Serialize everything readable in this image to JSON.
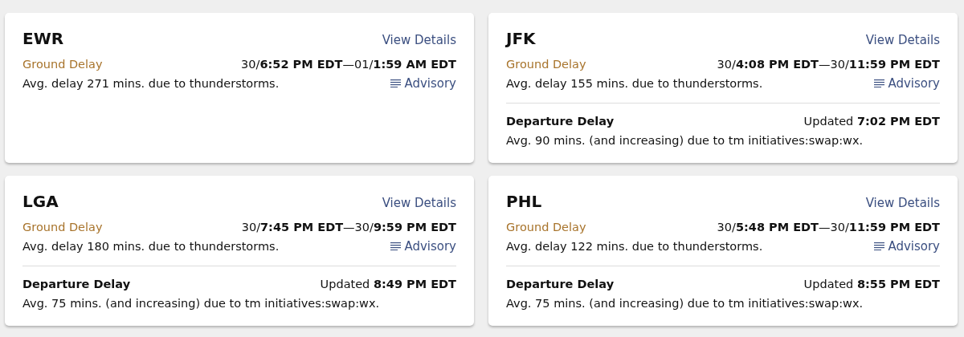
{
  "airports": [
    {
      "code": "EWR",
      "link": "View Details",
      "delays": [
        {
          "kind": "ground",
          "title": "Ground Delay",
          "time": "30/**6:52 PM EDT**—01/**1:59 AM EDT**",
          "text": "Avg. delay 271 mins. due to thunderstorms.",
          "advisory": "Advisory"
        }
      ]
    },
    {
      "code": "JFK",
      "link": "View Details",
      "delays": [
        {
          "kind": "ground",
          "title": "Ground Delay",
          "time": "30/**4:08 PM EDT**—30/**11:59 PM EDT**",
          "text": "Avg. delay 155 mins. due to thunderstorms.",
          "advisory": "Advisory"
        },
        {
          "kind": "departure",
          "title": "Departure Delay",
          "time": "Updated **7:02 PM EDT**",
          "text": "Avg. 90 mins. (and increasing) due to tm initiatives:swap:wx."
        }
      ]
    },
    {
      "code": "LGA",
      "link": "View Details",
      "delays": [
        {
          "kind": "ground",
          "title": "Ground Delay",
          "time": "30/**7:45 PM EDT**—30/**9:59 PM EDT**",
          "text": "Avg. delay 180 mins. due to thunderstorms.",
          "advisory": "Advisory"
        },
        {
          "kind": "departure",
          "title": "Departure Delay",
          "time": "Updated **8:49 PM EDT**",
          "text": "Avg. 75 mins. (and increasing) due to tm initiatives:swap:wx."
        }
      ]
    },
    {
      "code": "PHL",
      "link": "View Details",
      "delays": [
        {
          "kind": "ground",
          "title": "Ground Delay",
          "time": "30/**5:48 PM EDT**—30/**11:59 PM EDT**",
          "text": "Avg. delay 122 mins. due to thunderstorms.",
          "advisory": "Advisory"
        },
        {
          "kind": "departure",
          "title": "Departure Delay",
          "time": "Updated **8:55 PM EDT**",
          "text": "Avg. 75 mins. (and increasing) due to tm initiatives:swap:wx."
        }
      ]
    }
  ]
}
